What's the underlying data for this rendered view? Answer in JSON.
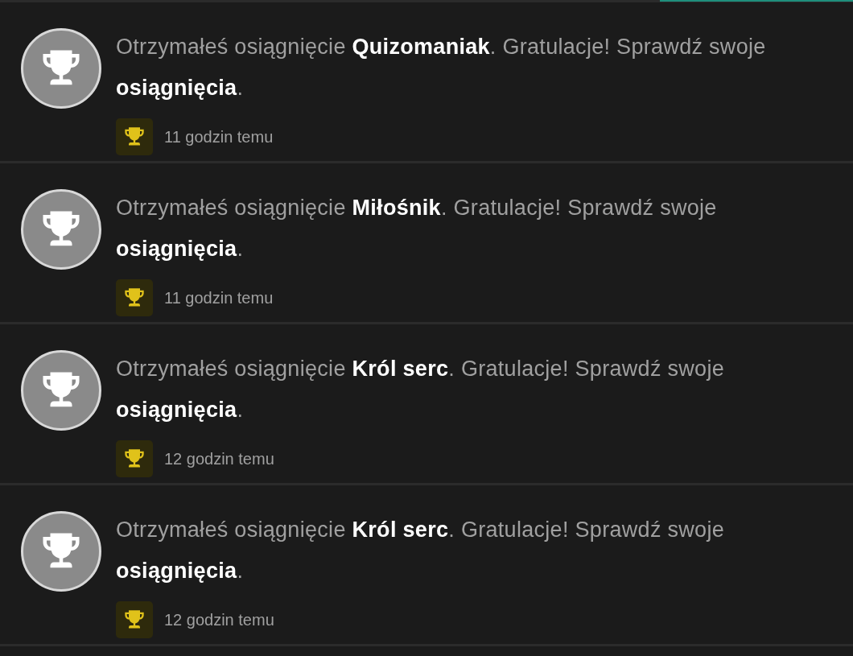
{
  "notifications": [
    {
      "message": "Otrzymałeś osiągnięcie **Quizomaniak**. Gratulacje! Sprawdź swoje",
      "link": "osiągnięcia",
      "end": ".",
      "time": "11 godzin temu"
    },
    {
      "message": "Otrzymałeś osiągnięcie **Miłośnik**. Gratulacje! Sprawdź swoje",
      "link": "osiągnięcia",
      "end": ".",
      "time": "11 godzin temu"
    },
    {
      "message": "Otrzymałeś osiągnięcie **Król serc**. Gratulacje! Sprawdź swoje",
      "link": "osiągnięcia",
      "end": ".",
      "time": "12 godzin temu"
    },
    {
      "message": "Otrzymałeś osiągnięcie **Król serc**. Gratulacje! Sprawdź swoje",
      "link": "osiągnięcia",
      "end": ".",
      "time": "12 godzin temu"
    }
  ]
}
